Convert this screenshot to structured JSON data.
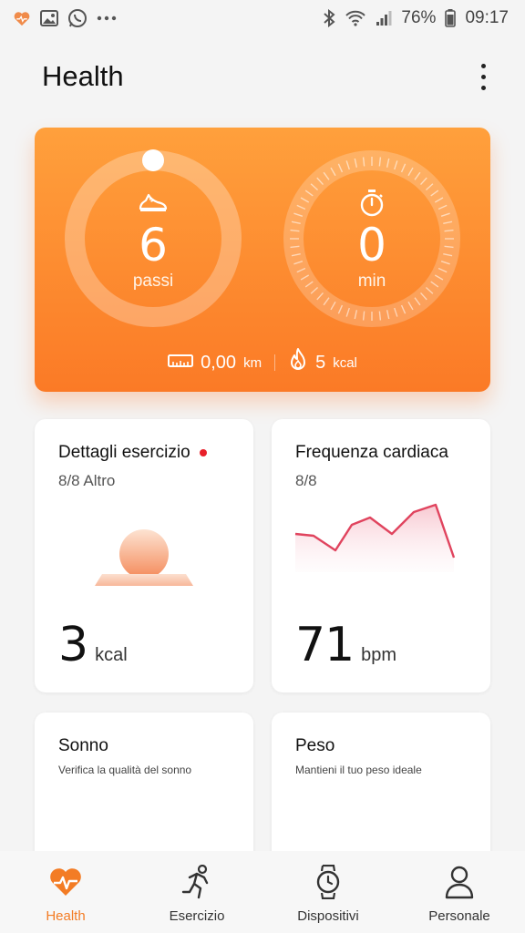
{
  "status_bar": {
    "battery": "76%",
    "time": "09:17",
    "left_icons": [
      "heart-icon",
      "gallery-icon",
      "whatsapp-icon",
      "more-dots-icon"
    ],
    "right_icons": [
      "bluetooth-icon",
      "wifi-icon",
      "signal-icon",
      "battery-icon"
    ]
  },
  "header": {
    "title": "Health"
  },
  "activity": {
    "steps_value": "6",
    "steps_unit": "passi",
    "time_value": "0",
    "time_unit": "min",
    "distance_value": "0,00",
    "distance_unit": "km",
    "calories_value": "5",
    "calories_unit": "kcal"
  },
  "tiles": {
    "exercise": {
      "title": "Dettagli esercizio",
      "subtitle": "8/8 Altro",
      "value": "3",
      "unit": "kcal"
    },
    "heart": {
      "title": "Frequenza cardiaca",
      "subtitle": "8/8",
      "value": "71",
      "unit": "bpm"
    },
    "sleep": {
      "title": "Sonno",
      "subtitle": "Verifica la qualità del sonno"
    },
    "weight": {
      "title": "Peso",
      "subtitle": "Mantieni il tuo peso ideale"
    }
  },
  "nav": [
    {
      "label": "Health",
      "icon": "heart-pulse-icon",
      "active": true
    },
    {
      "label": "Esercizio",
      "icon": "running-icon",
      "active": false
    },
    {
      "label": "Dispositivi",
      "icon": "watch-icon",
      "active": false
    },
    {
      "label": "Personale",
      "icon": "person-icon",
      "active": false
    }
  ],
  "colors": {
    "accent": "#f37c25",
    "card_gradient_top": "#ffa03c",
    "card_gradient_bottom": "#fb7a26",
    "heart_line": "#e0445e",
    "notification_dot": "#e8202a"
  }
}
